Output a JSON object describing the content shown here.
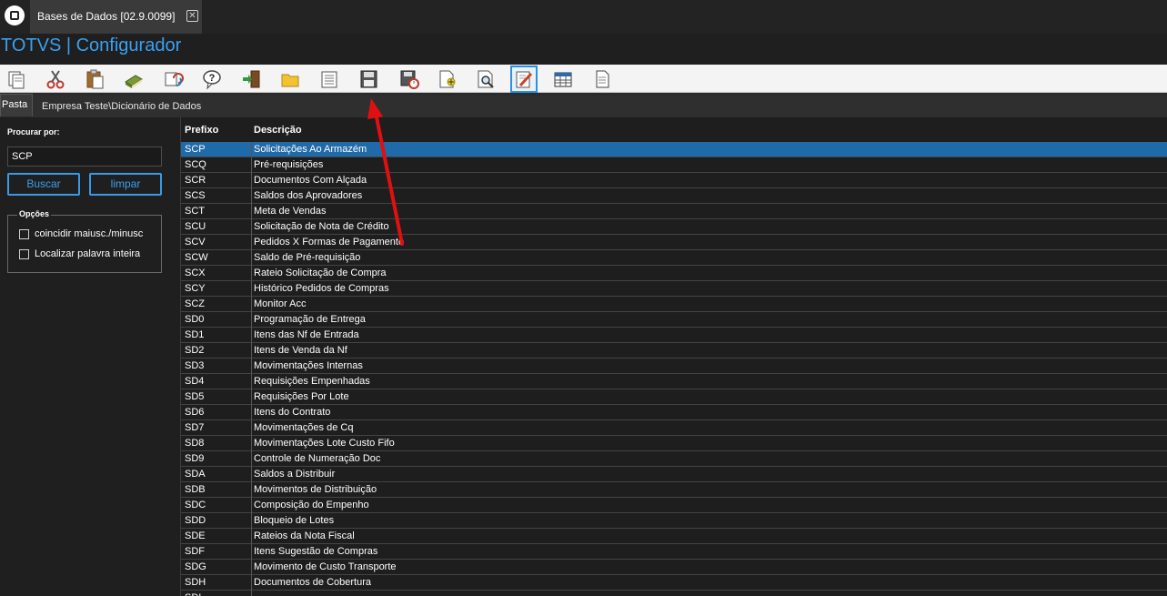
{
  "tab": {
    "title": "Bases de Dados [02.9.0099]",
    "close_glyph": "✕"
  },
  "app": {
    "title": "TOTVS | Configurador",
    "title_color": "#3aa0f0"
  },
  "toolbar": {
    "buttons": [
      {
        "name": "copy-icon"
      },
      {
        "name": "cut-icon"
      },
      {
        "name": "paste-icon"
      },
      {
        "name": "book-icon"
      },
      {
        "name": "refresh-icon"
      },
      {
        "name": "help-icon"
      },
      {
        "name": "exit-icon"
      },
      {
        "name": "folder-icon"
      },
      {
        "name": "list-icon"
      },
      {
        "name": "save-icon"
      },
      {
        "name": "save-clock-icon"
      },
      {
        "name": "new-document-icon"
      },
      {
        "name": "preview-icon"
      },
      {
        "name": "edit-icon",
        "selected": true
      },
      {
        "name": "table-icon"
      },
      {
        "name": "document-icon"
      }
    ]
  },
  "folder_tab": {
    "label": "Pasta"
  },
  "path": "Empresa Teste\\Dicionário de Dados",
  "search": {
    "label": "Procurar por:",
    "value": "SCP",
    "buscar_label": "Buscar",
    "limpar_label": "limpar"
  },
  "options": {
    "legend": "Opções",
    "match_case": "coincidir maiusc./minusc",
    "whole_word": "Localizar palavra inteira"
  },
  "grid": {
    "columns": [
      "Prefixo",
      "Descrição"
    ],
    "selected_row": 0,
    "selected_color": "#1f6aa8",
    "rows": [
      [
        "SCP",
        "Solicitações Ao Armazém"
      ],
      [
        "SCQ",
        "Pré-requisições"
      ],
      [
        "SCR",
        "Documentos Com Alçada"
      ],
      [
        "SCS",
        "Saldos dos Aprovadores"
      ],
      [
        "SCT",
        "Meta de Vendas"
      ],
      [
        "SCU",
        "Solicitação de Nota de Crédito"
      ],
      [
        "SCV",
        "Pedidos X Formas de Pagamento"
      ],
      [
        "SCW",
        "Saldo de Pré-requisição"
      ],
      [
        "SCX",
        "Rateio Solicitação de Compra"
      ],
      [
        "SCY",
        "Histórico Pedidos de Compras"
      ],
      [
        "SCZ",
        "Monitor Acc"
      ],
      [
        "SD0",
        "Programação de Entrega"
      ],
      [
        "SD1",
        "Itens das Nf de Entrada"
      ],
      [
        "SD2",
        "Itens de Venda da Nf"
      ],
      [
        "SD3",
        "Movimentações Internas"
      ],
      [
        "SD4",
        "Requisições Empenhadas"
      ],
      [
        "SD5",
        "Requisições Por Lote"
      ],
      [
        "SD6",
        "Itens do Contrato"
      ],
      [
        "SD7",
        "Movimentações de Cq"
      ],
      [
        "SD8",
        "Movimentações Lote Custo Fifo"
      ],
      [
        "SD9",
        "Controle de Numeração Doc"
      ],
      [
        "SDA",
        "Saldos a Distribuir"
      ],
      [
        "SDB",
        "Movimentos de Distribuição"
      ],
      [
        "SDC",
        "Composição do Empenho"
      ],
      [
        "SDD",
        "Bloqueio de Lotes"
      ],
      [
        "SDE",
        "Rateios da Nota Fiscal"
      ],
      [
        "SDF",
        "Itens Sugestão de Compras"
      ],
      [
        "SDG",
        "Movimento de Custo Transporte"
      ],
      [
        "SDH",
        "Documentos de Cobertura"
      ],
      [
        "SDI",
        ""
      ]
    ]
  },
  "annotation": {
    "color": "#e01010"
  }
}
